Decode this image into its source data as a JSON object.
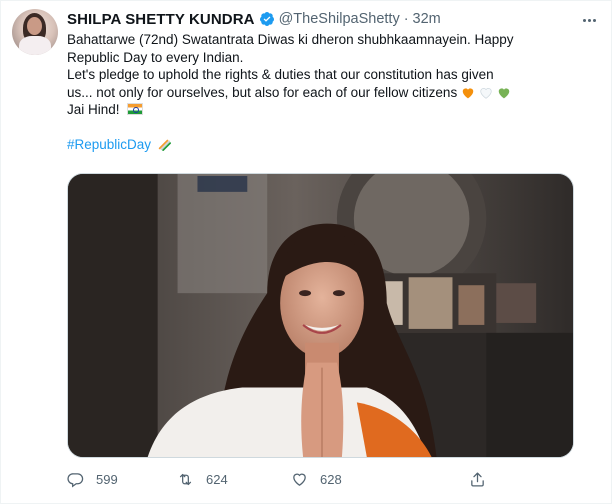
{
  "tweet": {
    "author": {
      "display_name": "SHILPA SHETTY KUNDRA",
      "handle": "@TheShilpaShetty",
      "verified": true,
      "time": "32m"
    },
    "body": {
      "line1": "Bahattarwe (72nd) Swatantrata Diwas ki dheron shubhkaamnayein. Happy",
      "line2": "Republic Day to every Indian.",
      "line3": "Let's pledge to uphold the rights & duties that our constitution has given",
      "line4": "us... not only for ourselves, but also for each of our fellow citizens",
      "line5": "Jai Hind!",
      "hashtag": "#RepublicDay"
    },
    "emojis": [
      "orange-heart-icon",
      "white-heart-icon",
      "green-heart-icon",
      "india-flag-icon",
      "tricolor-sparkle-icon"
    ],
    "actions": {
      "reply_count": "599",
      "retweet_count": "624",
      "like_count": "628"
    }
  },
  "colors": {
    "accent": "#1d9bf0",
    "secondary_text": "#536471",
    "saffron": "#f59d31",
    "green": "#1f9b38"
  }
}
